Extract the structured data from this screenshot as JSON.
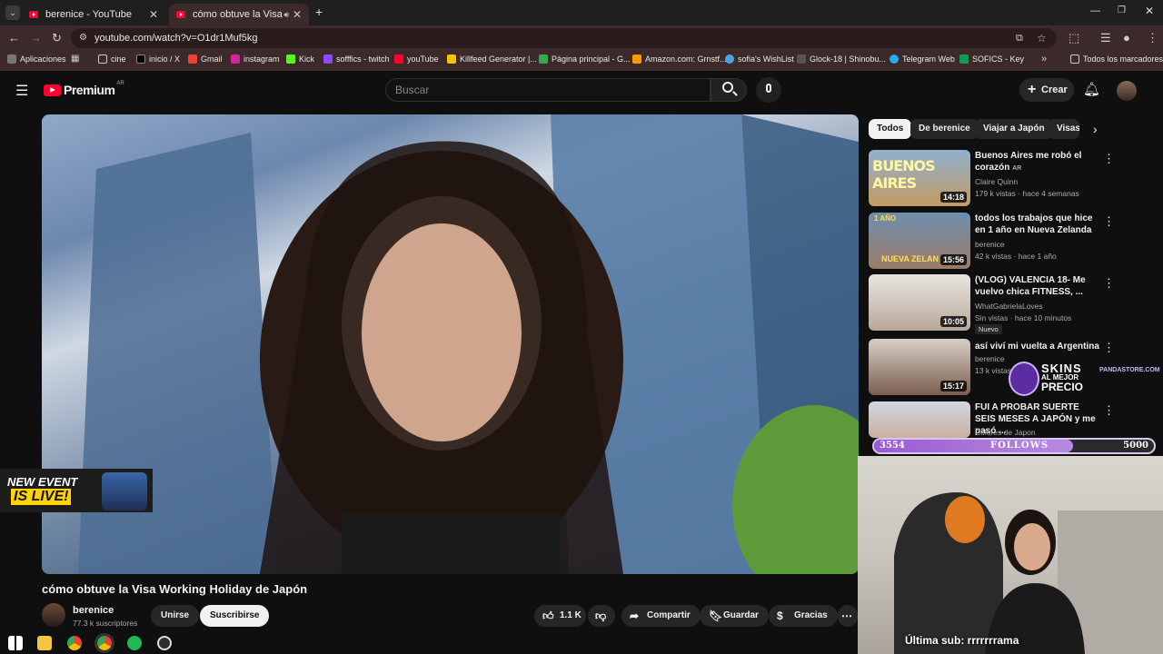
{
  "browser": {
    "tabs": [
      {
        "label": "berenice - YouTube"
      },
      {
        "label": "cómo obtuve la Visa Workin"
      }
    ],
    "new_tab": "+",
    "url": "youtube.com/watch?v=O1dr1Muf5kg",
    "bookmarks": [
      "Aplicaciones",
      "cine",
      "inicio / X",
      "Gmail",
      "instagram",
      "Kick",
      "sofffics - twitch",
      "youTube",
      "Killfeed Generator |...",
      "Página principal - G...",
      "Amazon.com: Grnstf...",
      "sofia's WishList",
      "Glock-18 | Shinobu...",
      "Telegram Web",
      "SOFICS - Key"
    ],
    "all_bookmarks": "Todos los marcadores"
  },
  "youtube": {
    "logo": "Premium",
    "region": "AR",
    "search_placeholder": "Buscar",
    "create_label": "Crear"
  },
  "video": {
    "title": "cómo obtuve la Visa Working Holiday de Japón",
    "channel": "berenice",
    "subscribers": "77.3 k suscriptores",
    "join_label": "Unirse",
    "subscribe_label": "Suscribirse",
    "likes": "1.1 K",
    "share_label": "Compartir",
    "save_label": "Guardar",
    "thanks_label": "Gracias"
  },
  "chips": [
    "Todos",
    "De berenice",
    "Viajar a Japón",
    "Visas"
  ],
  "recommendations": [
    {
      "title": "Buenos Aires me robó el corazón",
      "badge": "AR",
      "channel": "Claire Quinn",
      "meta": "179 k vistas · hace 4 semanas",
      "duration": "14:18",
      "thumb_text": "BUENOS AIRES"
    },
    {
      "title": "todos los trabajos que hice en 1 año en Nueva Zelanda",
      "channel": "berenice",
      "meta": "42 k vistas · hace 1 año",
      "duration": "15:56",
      "thumb_text": "NUEVA ZELAN",
      "thumb_top": "1 AÑO"
    },
    {
      "title": "(VLOG) VALENCIA 18- Me vuelvo chica FITNESS, ...",
      "channel": "WhatGabrielaLoves",
      "meta": "Sin vistas · hace 10 minutos",
      "duration": "10:05",
      "badge_new": "Nuevo"
    },
    {
      "title": "así viví mi vuelta a Argentina",
      "channel": "berenice",
      "meta": "13 k vistas",
      "duration": "15:17"
    },
    {
      "title": "FUI A PROBAR SUERTE SEIS MESES A JAPÓN y me pasó ...",
      "channel": "Colores de Japon"
    }
  ],
  "overlays": {
    "event_text_1": "NEW EVENT",
    "event_text_2": "IS LIVE!",
    "follows_current": "3554",
    "follows_label": "FOLLOWS",
    "follows_goal": "5000",
    "follows_progress": 0.71,
    "skins_line1": "SKINS",
    "skins_line2": "AL MEJOR",
    "skins_line3": "PRECIO",
    "skins_brand": "PANDASTORE.COM",
    "last_sub": "Última sub: rrrrrrrama"
  },
  "colors": {
    "youtube_red": "#ff0033",
    "background": "#0f0f0f",
    "chip_bg": "#272727",
    "browser_frame": "#3c2a2a"
  }
}
